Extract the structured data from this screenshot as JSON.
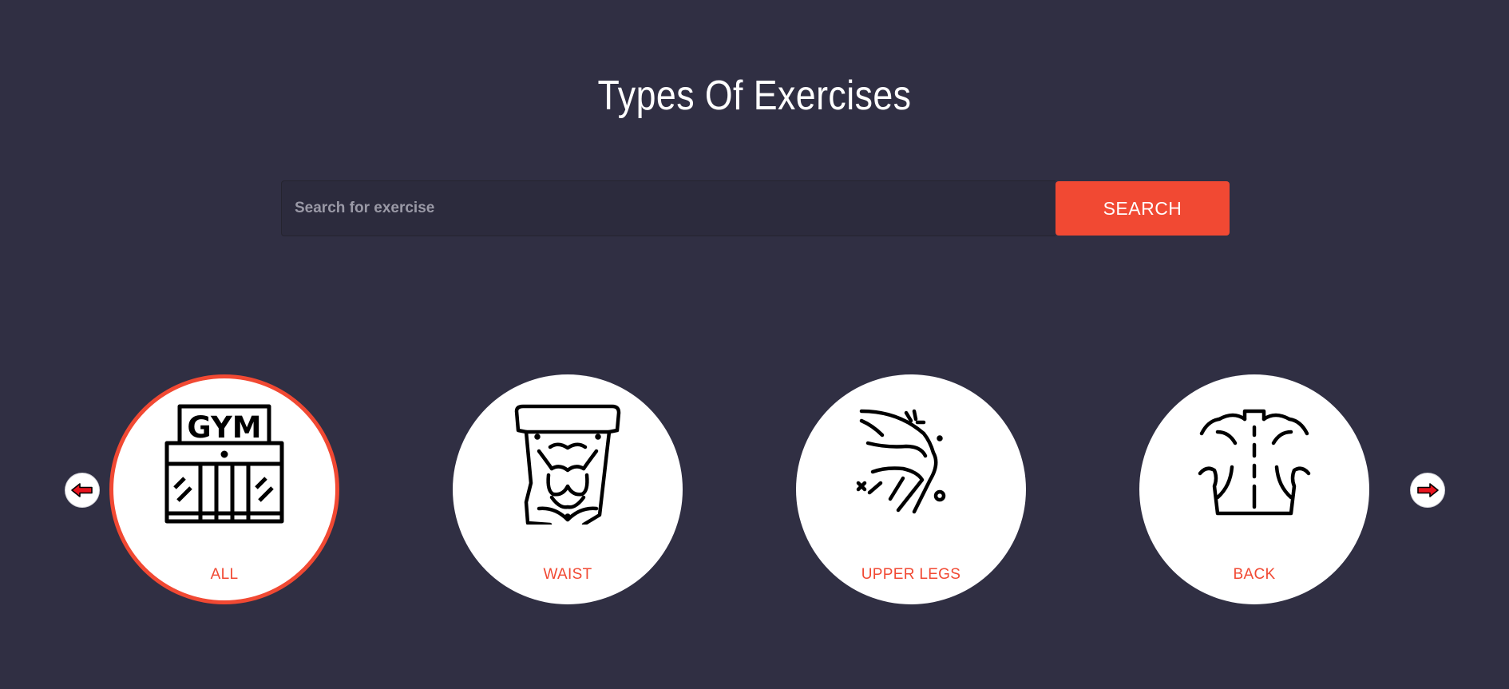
{
  "header": {
    "title": "Types Of Exercises"
  },
  "search": {
    "placeholder": "Search for exercise",
    "value": "",
    "button_label": "SEARCH"
  },
  "carousel": {
    "prev_icon": "arrow-left-icon",
    "next_icon": "arrow-right-icon",
    "items": [
      {
        "label": "ALL",
        "icon": "gym-building-icon",
        "selected": true
      },
      {
        "label": "WAIST",
        "icon": "abs-torso-icon",
        "selected": false
      },
      {
        "label": "UPPER LEGS",
        "icon": "upper-leg-icon",
        "selected": false
      },
      {
        "label": "BACK",
        "icon": "back-muscles-icon",
        "selected": false
      }
    ]
  },
  "colors": {
    "background": "#302f43",
    "accent": "#f14933",
    "card": "#ffffff",
    "arrow": "#e8141e"
  }
}
